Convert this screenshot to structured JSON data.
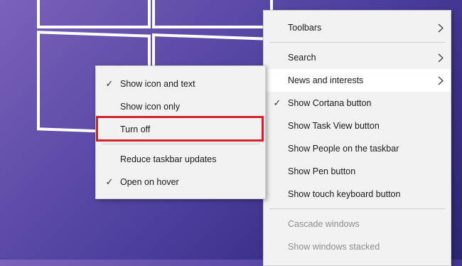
{
  "colors": {
    "menu_background": "#f2f2f2",
    "highlight_border": "#d5202a",
    "disabled_text": "#8e8e8e"
  },
  "context_menu": {
    "items": [
      {
        "label": "Toolbars",
        "has_submenu": true
      },
      {
        "label": "Search",
        "has_submenu": true
      },
      {
        "label": "News and interests",
        "has_submenu": true,
        "hover": true
      },
      {
        "label": "Show Cortana button",
        "checked": true
      },
      {
        "label": "Show Task View button"
      },
      {
        "label": "Show People on the taskbar"
      },
      {
        "label": "Show Pen button"
      },
      {
        "label": "Show touch keyboard button"
      },
      {
        "label": "Cascade windows",
        "disabled": true
      },
      {
        "label": "Show windows stacked",
        "disabled": true
      }
    ]
  },
  "news_submenu": {
    "items": [
      {
        "label": "Show icon and text",
        "checked": true
      },
      {
        "label": "Show icon only"
      },
      {
        "label": "Turn off",
        "highlighted": true
      },
      {
        "label": "Reduce taskbar updates"
      },
      {
        "label": "Open on hover",
        "checked": true
      }
    ]
  },
  "icons": {
    "check": "checkmark-icon",
    "submenu_arrow": "chevron-right-icon",
    "logo": "windows-logo"
  }
}
